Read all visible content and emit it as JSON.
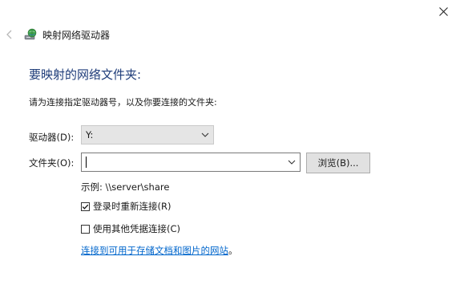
{
  "window": {
    "title": "映射网络驱动器",
    "close_icon": "close-icon",
    "back_icon": "back-arrow-icon",
    "app_icon": "network-drive-icon"
  },
  "main": {
    "heading": "要映射的网络文件夹:",
    "instruction": "请为连接指定驱动器号，以及你要连接的文件夹:",
    "drive": {
      "label": "驱动器(D):",
      "value": "Y:"
    },
    "folder": {
      "label": "文件夹(O):",
      "value": ""
    },
    "browse_button": "浏览(B)...",
    "example": "示例: \\\\server\\share",
    "reconnect": {
      "label": "登录时重新连接(R)",
      "checked": true
    },
    "other_credentials": {
      "label": "使用其他凭据连接(C)",
      "checked": false
    },
    "link_text": "连接到可用于存储文档和图片的网站",
    "link_suffix": "。"
  },
  "colors": {
    "heading": "#1f3d7a",
    "link": "#0066cc"
  }
}
